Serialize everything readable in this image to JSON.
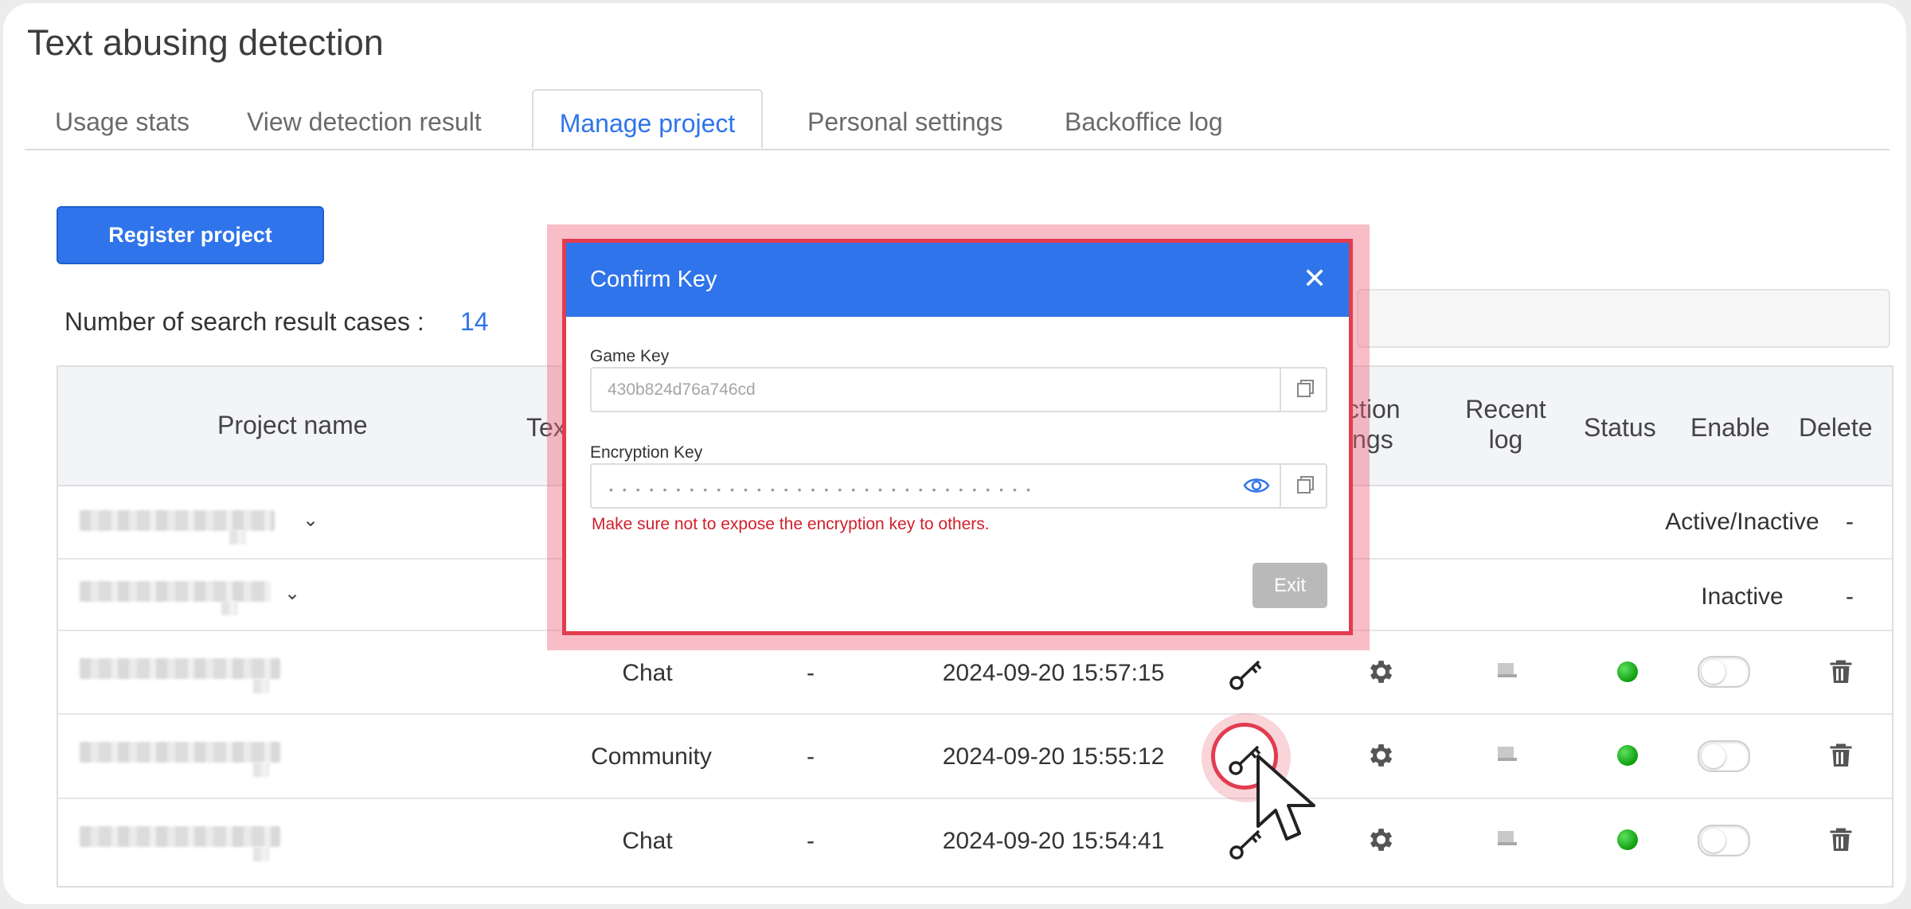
{
  "app": {
    "title": "Text abusing detection"
  },
  "tabs": [
    {
      "label": "Usage stats"
    },
    {
      "label": "View detection result"
    },
    {
      "label": "Manage project",
      "active": true
    },
    {
      "label": "Personal settings"
    },
    {
      "label": "Backoffice log"
    }
  ],
  "toolbar": {
    "register_label": "Register project"
  },
  "summary": {
    "count_label": "Number of search result cases :",
    "count_value": "14"
  },
  "table": {
    "headers": {
      "project_name": "Project name",
      "text_type_partial": "Tex",
      "detection_settings_line1": "ction",
      "detection_settings_line2": "ings",
      "recent_log_line1": "Recent",
      "recent_log_line2": "log",
      "status": "Status",
      "enable": "Enable",
      "delete": "Delete"
    },
    "rows": [
      {
        "project_name": "[redacted]",
        "expandable": true,
        "enable_text": "Active/Inactive",
        "delete_text": "-"
      },
      {
        "project_name": "[redacted]",
        "expandable": true,
        "enable_text": "Inactive",
        "delete_text": "-"
      },
      {
        "project_name": "[redacted]",
        "text_type": "Chat",
        "col3": "-",
        "registered_at": "2024-09-20 15:57:15",
        "status_color": "#1faa1f",
        "enabled": false
      },
      {
        "project_name": "[redacted]",
        "text_type": "Community",
        "col3": "-",
        "registered_at": "2024-09-20 15:55:12",
        "status_color": "#1faa1f",
        "enabled": false,
        "highlighted": true
      },
      {
        "project_name": "[redacted]",
        "text_type": "Chat",
        "col3": "-",
        "registered_at": "2024-09-20 15:54:41",
        "status_color": "#1faa1f",
        "enabled": false
      }
    ]
  },
  "modal": {
    "title": "Confirm Key",
    "close_icon": "close-icon",
    "game_key": {
      "label": "Game Key",
      "value": "430b824d76a746cd"
    },
    "encryption_key": {
      "label": "Encryption Key",
      "masked": "••••••••••••••••••••••••••••••••"
    },
    "warning": "Make sure not to expose the encryption key to others.",
    "exit_label": "Exit"
  },
  "colors": {
    "accent": "#2f74ea",
    "highlight": "#e23c50",
    "warning": "#d21f2c",
    "status_on": "#1faa1f"
  }
}
